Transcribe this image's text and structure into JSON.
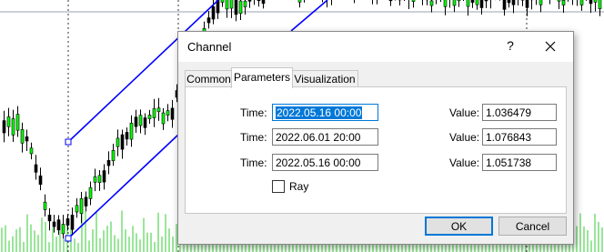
{
  "dialog": {
    "title": "Channel",
    "help_label": "?",
    "tabs": [
      {
        "label": "Common"
      },
      {
        "label": "Parameters"
      },
      {
        "label": "Visualization"
      }
    ],
    "rows": [
      {
        "time_label": "Time:",
        "time_value": "2022.05.16 00:00",
        "value_label": "Value:",
        "value": "1.036479"
      },
      {
        "time_label": "Time:",
        "time_value": "2022.06.01 20:00",
        "value_label": "Value:",
        "value": "1.076843"
      },
      {
        "time_label": "Time:",
        "time_value": "2022.05.16 00:00",
        "value_label": "Value:",
        "value": "1.051738"
      }
    ],
    "ray_label": "Ray",
    "ray_checked": false,
    "ok_label": "OK",
    "cancel_label": "Cancel"
  },
  "colors": {
    "candle": "#000000",
    "bull_candle": "#00ff00",
    "volume": "#33cc33",
    "channel_line": "#0000ff",
    "accent": "#0078d7"
  }
}
